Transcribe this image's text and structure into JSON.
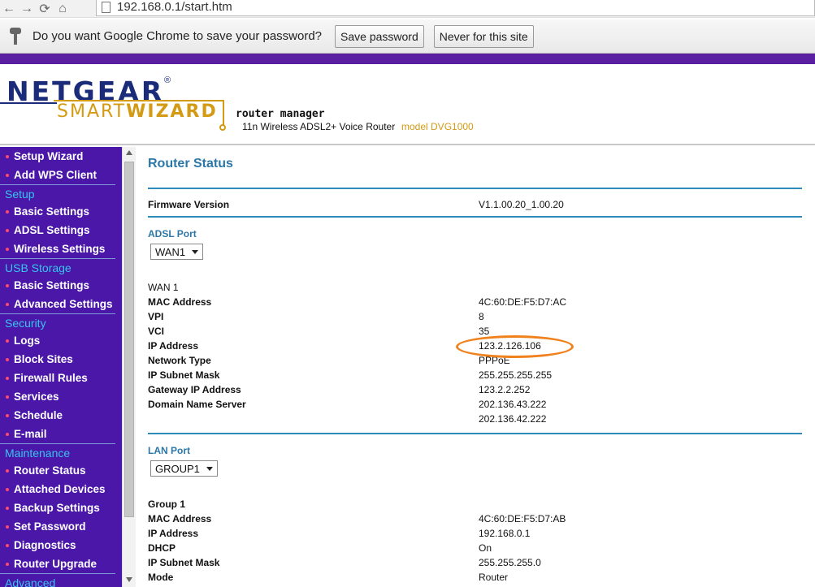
{
  "browser": {
    "url": "192.168.0.1/start.htm"
  },
  "password_bar": {
    "message": "Do you want Google Chrome to save your password?",
    "save_label": "Save password",
    "never_label": "Never for this site"
  },
  "header": {
    "brand": "NETGEAR",
    "smart": "SMART",
    "wizard": "WIZARD",
    "router_manager": "router manager",
    "router_desc": "11n Wireless ADSL2+ Voice Router",
    "model": "model DVG1000"
  },
  "sidebar": {
    "items": [
      {
        "label": "Setup Wizard",
        "type": "item"
      },
      {
        "label": "Add WPS Client",
        "type": "item"
      },
      {
        "label": "Setup",
        "type": "head"
      },
      {
        "label": "Basic Settings",
        "type": "item"
      },
      {
        "label": "ADSL Settings",
        "type": "item"
      },
      {
        "label": "Wireless Settings",
        "type": "item"
      },
      {
        "label": "USB Storage",
        "type": "head"
      },
      {
        "label": "Basic Settings",
        "type": "item"
      },
      {
        "label": "Advanced Settings",
        "type": "item"
      },
      {
        "label": "Security",
        "type": "head"
      },
      {
        "label": "Logs",
        "type": "item"
      },
      {
        "label": "Block Sites",
        "type": "item"
      },
      {
        "label": "Firewall Rules",
        "type": "item"
      },
      {
        "label": "Services",
        "type": "item"
      },
      {
        "label": "Schedule",
        "type": "item"
      },
      {
        "label": "E-mail",
        "type": "item"
      },
      {
        "label": "Maintenance",
        "type": "head"
      },
      {
        "label": "Router Status",
        "type": "item"
      },
      {
        "label": "Attached Devices",
        "type": "item"
      },
      {
        "label": "Backup Settings",
        "type": "item"
      },
      {
        "label": "Set Password",
        "type": "item"
      },
      {
        "label": "Diagnostics",
        "type": "item"
      },
      {
        "label": "Router Upgrade",
        "type": "item"
      },
      {
        "label": "Advanced",
        "type": "head"
      }
    ]
  },
  "main": {
    "title": "Router Status",
    "firmware": {
      "label": "Firmware Version",
      "value": "V1.1.00.20_1.00.20"
    },
    "adsl": {
      "section": "ADSL Port",
      "select": "WAN1",
      "group": "WAN 1",
      "rows": [
        {
          "label": "MAC Address",
          "value": "4C:60:DE:F5:D7:AC"
        },
        {
          "label": "VPI",
          "value": "8"
        },
        {
          "label": "VCI",
          "value": "35"
        },
        {
          "label": "IP Address",
          "value": "123.2.126.106"
        },
        {
          "label": "Network Type",
          "value": "PPPoE"
        },
        {
          "label": "IP Subnet Mask",
          "value": "255.255.255.255"
        },
        {
          "label": "Gateway IP Address",
          "value": "123.2.2.252"
        },
        {
          "label": "Domain Name Server",
          "value": "202.136.43.222"
        },
        {
          "label": "",
          "value": "202.136.42.222"
        }
      ]
    },
    "lan": {
      "section": "LAN Port",
      "select": "GROUP1",
      "group": "Group 1",
      "rows": [
        {
          "label": "MAC Address",
          "value": "4C:60:DE:F5:D7:AB"
        },
        {
          "label": "IP Address",
          "value": "192.168.0.1"
        },
        {
          "label": "DHCP",
          "value": "On"
        },
        {
          "label": "IP Subnet Mask",
          "value": "255.255.255.0"
        },
        {
          "label": "Mode",
          "value": "Router"
        }
      ]
    }
  },
  "colors": {
    "sidebar_bg": "#4a17a8",
    "section_blue": "#2b77a8",
    "highlight_oval": "#f0821e"
  }
}
